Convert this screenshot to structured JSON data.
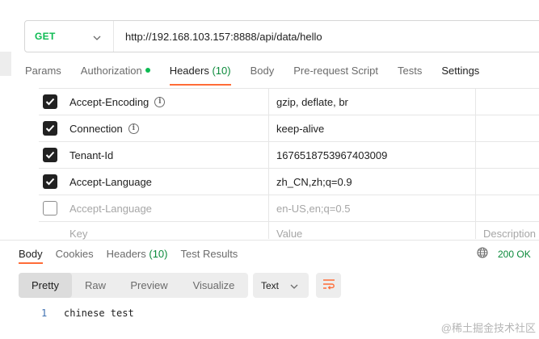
{
  "request": {
    "method": "GET",
    "url": "http://192.168.103.157:8888/api/data/hello"
  },
  "request_tabs": [
    {
      "label": "Params",
      "count": "",
      "active": false
    },
    {
      "label": "Authorization",
      "count": "",
      "active": false,
      "dot": true
    },
    {
      "label": "Headers",
      "count": "(10)",
      "active": true
    },
    {
      "label": "Body",
      "count": "",
      "active": false
    },
    {
      "label": "Pre-request Script",
      "count": "",
      "active": false
    },
    {
      "label": "Tests",
      "count": "",
      "active": false
    },
    {
      "label": "Settings",
      "count": "",
      "active": false
    }
  ],
  "headers": {
    "rows": [
      {
        "checked": true,
        "key": "Accept-Encoding",
        "info": true,
        "value": "gzip, deflate, br"
      },
      {
        "checked": true,
        "key": "Connection",
        "info": true,
        "value": "keep-alive"
      },
      {
        "checked": true,
        "key": "Tenant-Id",
        "info": false,
        "value": "1676518753967403009"
      },
      {
        "checked": true,
        "key": "Accept-Language",
        "info": false,
        "value": "zh_CN,zh;q=0.9"
      },
      {
        "checked": false,
        "key": "Accept-Language",
        "info": false,
        "value": "en-US,en;q=0.5"
      }
    ],
    "placeholder": {
      "key": "Key",
      "value": "Value",
      "description": "Description"
    }
  },
  "response": {
    "tabs": [
      {
        "label": "Body",
        "count": "",
        "active": true
      },
      {
        "label": "Cookies",
        "count": "",
        "active": false
      },
      {
        "label": "Headers",
        "count": "(10)",
        "active": false
      },
      {
        "label": "Test Results",
        "count": "",
        "active": false
      }
    ],
    "status": "200 OK",
    "views": [
      {
        "label": "Pretty",
        "active": true
      },
      {
        "label": "Raw",
        "active": false
      },
      {
        "label": "Preview",
        "active": false
      },
      {
        "label": "Visualize",
        "active": false
      }
    ],
    "format": "Text",
    "lines": [
      {
        "number": "1",
        "text": "chinese test"
      }
    ]
  },
  "watermark": "@稀土掘金技术社区",
  "colors": {
    "accent": "#ff6c37",
    "method": "#0cbb52",
    "status": "#0b8a3b"
  },
  "icons": [
    "chevron-down-icon",
    "info-icon",
    "checkbox-checked-icon",
    "checkbox-empty-icon",
    "globe-icon",
    "wrap-lines-icon"
  ]
}
